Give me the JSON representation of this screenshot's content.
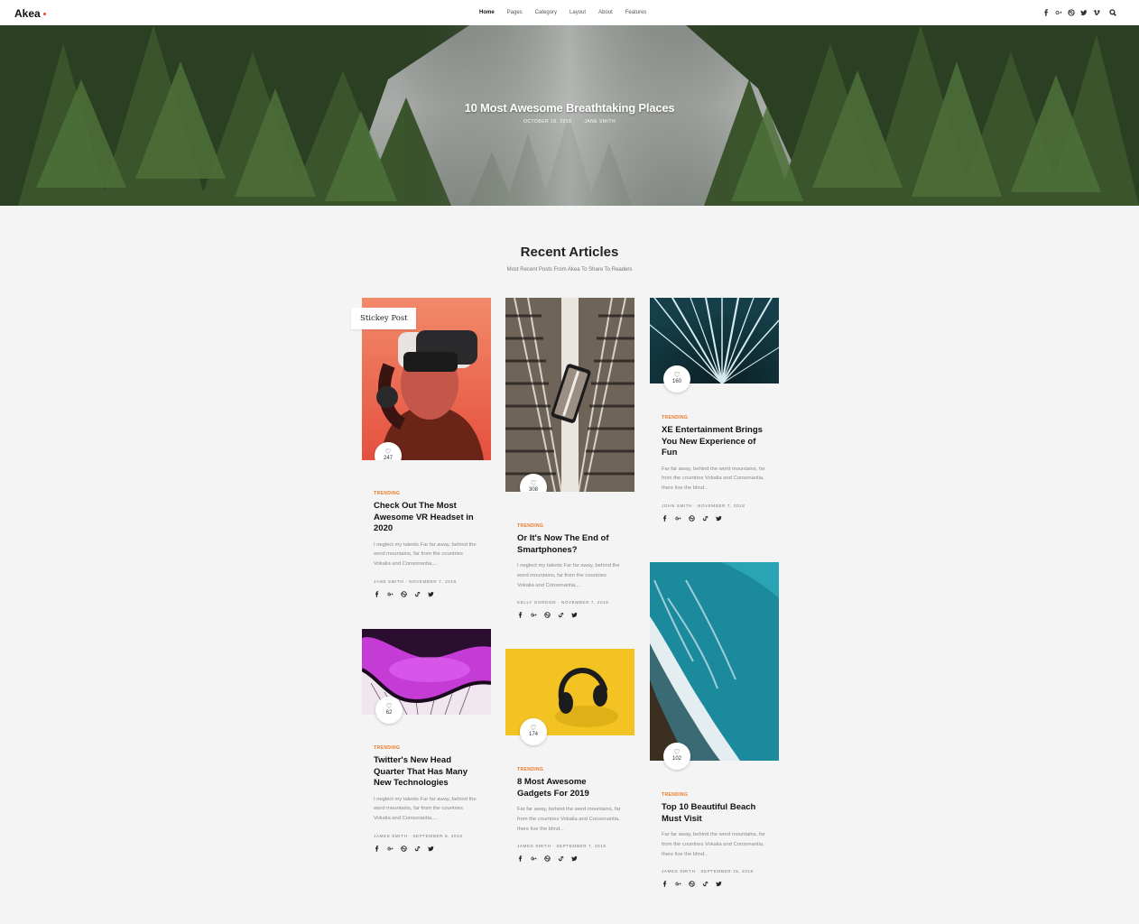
{
  "nav": {
    "logo": "Akea",
    "menu": [
      "Home",
      "Pages",
      "Category",
      "Layout",
      "About",
      "Features"
    ],
    "social_icons": [
      "facebook-icon",
      "google-plus-icon",
      "dribbble-icon",
      "twitter-icon",
      "vimeo-icon"
    ],
    "search_icon": "search-icon"
  },
  "hero": {
    "title": "10 Most Awesome Breathtaking Places",
    "date": "OCTOBER 18, 2018",
    "author": "JANE SMITH"
  },
  "section": {
    "title": "Recent Articles",
    "subtitle": "Most Recent Posts From Akea To Share To Readers"
  },
  "sticky_label": "Stickey Post",
  "colors": {
    "accent": "#e87722",
    "logo_dot": "#e4452c"
  },
  "cards": [
    {
      "likes": "247",
      "category": "TRENDING",
      "title": "Check Out The Most Awesome VR Headset in 2020",
      "excerpt": "I neglect my talents Far far away, behind the word mountains, far from the countries Vokalia and Consonantia,...",
      "author": "JANE SMITH",
      "date": "NOVEMBER 7, 2018"
    },
    {
      "likes": "308",
      "category": "TRENDING",
      "title": "Or It's Now The End of Smartphones?",
      "excerpt": "I neglect my talents Far far away, behind the word mountains, far from the countries Vokalia and Consonantia,...",
      "author": "KELLY GORDON",
      "date": "NOVEMBER 7, 2018"
    },
    {
      "likes": "160",
      "category": "TRENDING",
      "title": "XE Entertainment Brings You New Experience of Fun",
      "excerpt": "Far far away, behind the word mountains, far from the countries Vokalia and Consonantia, there live the blind...",
      "author": "JOHN SMITH",
      "date": "NOVEMBER 7, 2018"
    },
    {
      "likes": "62",
      "category": "TRENDING",
      "title": "Twitter's New Head Quarter That Has Many New Technologies",
      "excerpt": "I neglect my talents Far far away, behind the word mountains, far from the countries Vokalia and Consonantia,...",
      "author": "JAMES SMITH",
      "date": "SEPTEMBER 5, 2018"
    },
    {
      "likes": "174",
      "category": "TRENDING",
      "title": "8 Most Awesome Gadgets For 2019",
      "excerpt": "Far far away, behind the word mountains, far from the countries Vokalia and Consonantia, there live the blind...",
      "author": "JAMES SMITH",
      "date": "SEPTEMBER 7, 2018"
    },
    {
      "likes": "102",
      "category": "TRENDING",
      "title": "Top 10 Beautiful Beach Must Visit",
      "excerpt": "Far far away, behind the word mountains, far from the countries Vokalia and Consonantia, there live the blind...",
      "author": "JAMES SMITH",
      "date": "SEPTEMBER 15, 2018"
    }
  ]
}
